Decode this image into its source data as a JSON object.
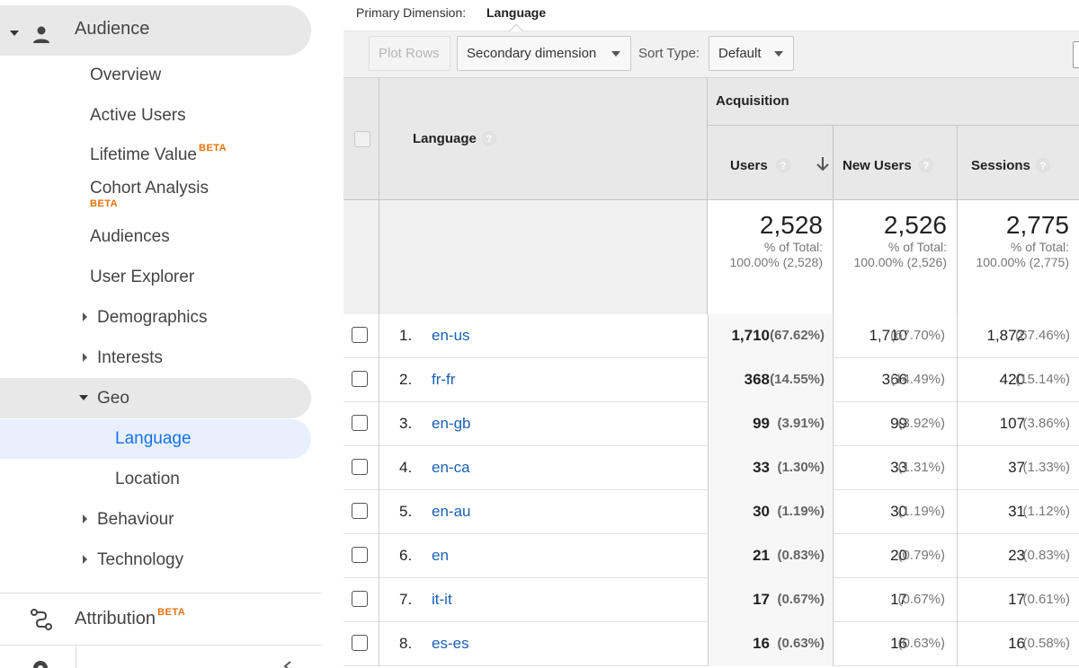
{
  "sidebar": {
    "section_label": "Audience",
    "items": [
      {
        "label": "Overview"
      },
      {
        "label": "Active Users"
      },
      {
        "label": "Lifetime Value",
        "badge": "BETA"
      },
      {
        "label": "Cohort Analysis",
        "badge": "BETA"
      },
      {
        "label": "Audiences"
      },
      {
        "label": "User Explorer"
      },
      {
        "label": "Demographics"
      },
      {
        "label": "Interests"
      },
      {
        "label": "Geo"
      },
      {
        "label": "Behaviour"
      },
      {
        "label": "Technology"
      }
    ],
    "geo_children": [
      {
        "label": "Language",
        "active": true
      },
      {
        "label": "Location"
      }
    ],
    "attribution": {
      "label": "Attribution",
      "badge": "BETA"
    }
  },
  "primary_dimension": {
    "label": "Primary Dimension:",
    "value": "Language"
  },
  "toolbar": {
    "plot_rows": "Plot Rows",
    "secondary_dimension": "Secondary dimension",
    "sort_type_label": "Sort Type:",
    "sort_type_value": "Default"
  },
  "table": {
    "dimension_header": "Language",
    "group_header": "Acquisition",
    "columns": [
      "Users",
      "New Users",
      "Sessions"
    ],
    "help_glyph": "?",
    "totals": [
      {
        "value": "2,528",
        "label": "% of Total:",
        "detail": "100.00% (2,528)"
      },
      {
        "value": "2,526",
        "label": "% of Total:",
        "detail": "100.00% (2,526)"
      },
      {
        "value": "2,775",
        "label": "% of Total:",
        "detail": "100.00% (2,775)"
      }
    ],
    "rows": [
      {
        "index": "1.",
        "language": "en-us",
        "users": "1,710",
        "users_pct": "(67.62%)",
        "new_users": "1,710",
        "new_users_pct": "(67.70%)",
        "sessions": "1,872",
        "sessions_pct": "(67.46%)"
      },
      {
        "index": "2.",
        "language": "fr-fr",
        "users": "368",
        "users_pct": "(14.55%)",
        "new_users": "366",
        "new_users_pct": "(14.49%)",
        "sessions": "420",
        "sessions_pct": "(15.14%)"
      },
      {
        "index": "3.",
        "language": "en-gb",
        "users": "99",
        "users_pct": "(3.91%)",
        "new_users": "99",
        "new_users_pct": "(3.92%)",
        "sessions": "107",
        "sessions_pct": "(3.86%)"
      },
      {
        "index": "4.",
        "language": "en-ca",
        "users": "33",
        "users_pct": "(1.30%)",
        "new_users": "33",
        "new_users_pct": "(1.31%)",
        "sessions": "37",
        "sessions_pct": "(1.33%)"
      },
      {
        "index": "5.",
        "language": "en-au",
        "users": "30",
        "users_pct": "(1.19%)",
        "new_users": "30",
        "new_users_pct": "(1.19%)",
        "sessions": "31",
        "sessions_pct": "(1.12%)"
      },
      {
        "index": "6.",
        "language": "en",
        "users": "21",
        "users_pct": "(0.83%)",
        "new_users": "20",
        "new_users_pct": "(0.79%)",
        "sessions": "23",
        "sessions_pct": "(0.83%)"
      },
      {
        "index": "7.",
        "language": "it-it",
        "users": "17",
        "users_pct": "(0.67%)",
        "new_users": "17",
        "new_users_pct": "(0.67%)",
        "sessions": "17",
        "sessions_pct": "(0.61%)"
      },
      {
        "index": "8.",
        "language": "es-es",
        "users": "16",
        "users_pct": "(0.63%)",
        "new_users": "16",
        "new_users_pct": "(0.63%)",
        "sessions": "16",
        "sessions_pct": "(0.58%)"
      }
    ]
  },
  "colors": {
    "link": "#1a5fb4",
    "active_nav": "#1a73e8",
    "beta_badge": "#e8710a"
  }
}
